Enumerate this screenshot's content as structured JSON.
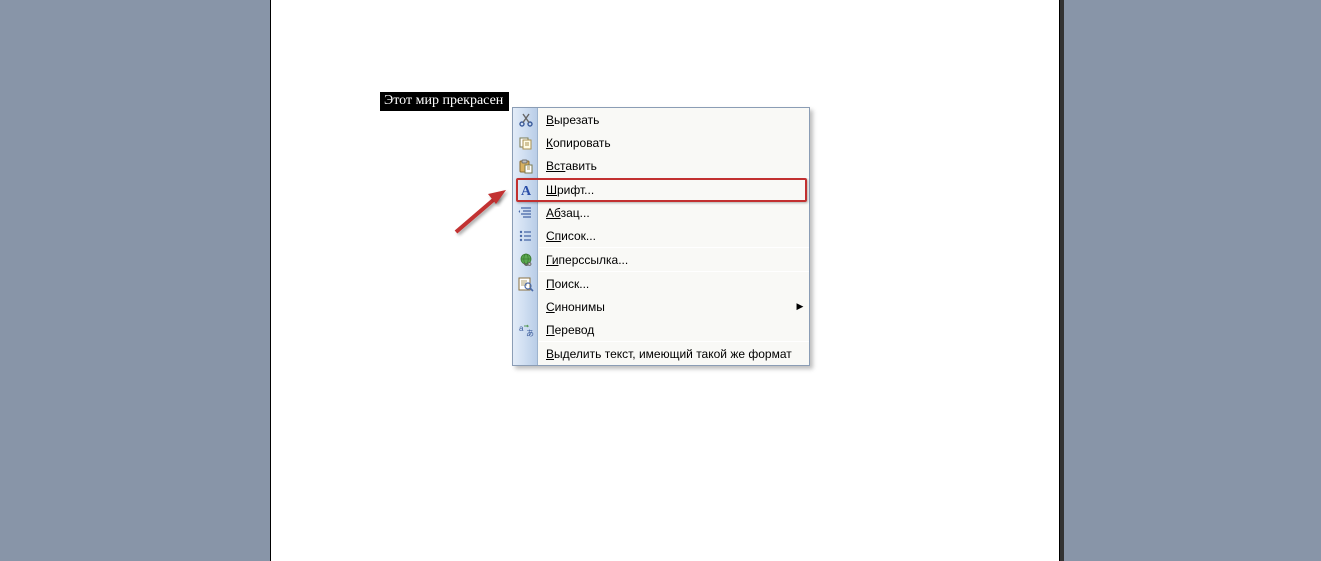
{
  "document": {
    "selected_text": "Этот мир прекрасен"
  },
  "context_menu": {
    "items": [
      {
        "label_pre": "В",
        "label_rest": "ырезать",
        "icon": "cut"
      },
      {
        "label_pre": "К",
        "label_rest": "опировать",
        "icon": "copy"
      },
      {
        "label_pre": "Вст",
        "label_rest": "авить",
        "icon": "paste"
      },
      {
        "label_pre": "Ш",
        "label_rest": "рифт...",
        "icon": "font"
      },
      {
        "label_pre": "Аб",
        "label_rest": "зац...",
        "icon": "paragraph"
      },
      {
        "label_pre": "Сп",
        "label_rest": "исок...",
        "icon": "list"
      },
      {
        "label_pre": "Ги",
        "label_rest": "перссылка...",
        "icon": "link"
      },
      {
        "label_pre": "П",
        "label_rest": "оиск...",
        "icon": "search"
      },
      {
        "label_pre": "С",
        "label_rest": "инонимы",
        "icon": "",
        "submenu": true
      },
      {
        "label_pre": "П",
        "label_rest": "еревод",
        "icon": "translate"
      },
      {
        "label_pre": "В",
        "label_rest": "ыделить текст, имеющий такой же формат",
        "icon": ""
      }
    ]
  }
}
